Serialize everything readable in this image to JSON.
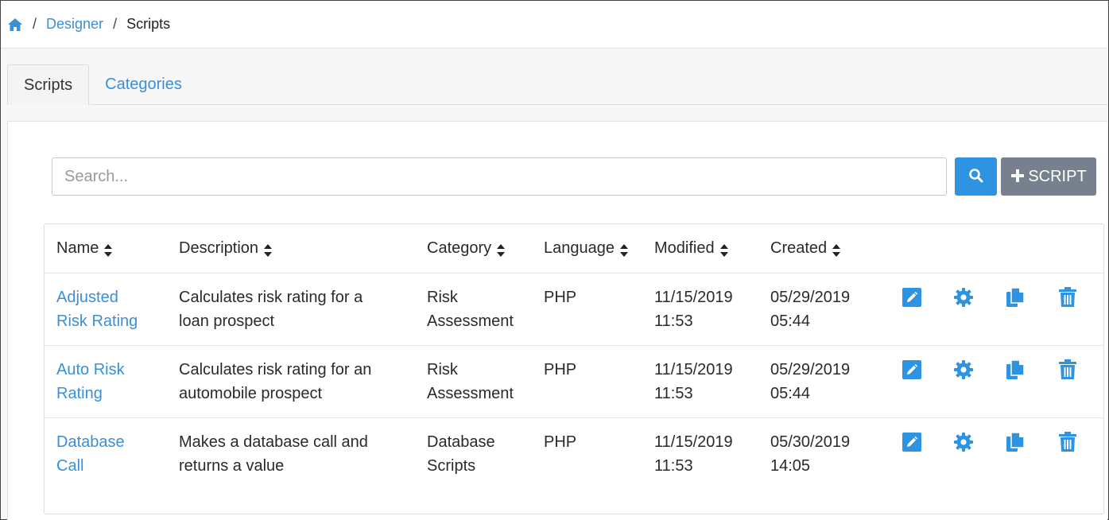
{
  "breadcrumb": {
    "separator": "/",
    "items": [
      {
        "label": "Designer"
      },
      {
        "label": "Scripts"
      }
    ]
  },
  "tabs": [
    {
      "label": "Scripts",
      "active": true
    },
    {
      "label": "Categories",
      "active": false
    }
  ],
  "search": {
    "placeholder": "Search...",
    "value": ""
  },
  "add_button": {
    "label": "SCRIPT"
  },
  "table": {
    "columns": [
      {
        "label": "Name"
      },
      {
        "label": "Description"
      },
      {
        "label": "Category"
      },
      {
        "label": "Language"
      },
      {
        "label": "Modified"
      },
      {
        "label": "Created"
      }
    ],
    "rows": [
      {
        "name_l1": "Adjusted",
        "name_l2": "Risk Rating",
        "desc_l1": "Calculates risk rating for a",
        "desc_l2": "loan prospect",
        "cat_l1": "Risk",
        "cat_l2": "Assessment",
        "language": "PHP",
        "modified_date": "11/15/2019",
        "modified_time": "11:53",
        "created_date": "05/29/2019",
        "created_time": "05:44"
      },
      {
        "name_l1": "Auto Risk",
        "name_l2": "Rating",
        "desc_l1": "Calculates risk rating for an",
        "desc_l2": "automobile prospect",
        "cat_l1": "Risk",
        "cat_l2": "Assessment",
        "language": "PHP",
        "modified_date": "11/15/2019",
        "modified_time": "11:53",
        "created_date": "05/29/2019",
        "created_time": "05:44"
      },
      {
        "name_l1": "Database",
        "name_l2": "Call",
        "desc_l1": "Makes a database call and",
        "desc_l2": "returns a value",
        "cat_l1": "Database",
        "cat_l2": "Scripts",
        "language": "PHP",
        "modified_date": "11/15/2019",
        "modified_time": "11:53",
        "created_date": "05/30/2019",
        "created_time": "14:05"
      }
    ]
  },
  "colors": {
    "link": "#3a8fd6",
    "primary_button": "#2e93e0",
    "secondary_button": "#77818d",
    "icon": "#2e93e0"
  },
  "icons": {
    "home": "home-icon",
    "search": "search-icon",
    "add": "plus-icon",
    "sort": "sort-icon",
    "edit": "edit-icon",
    "configure": "gear-icon",
    "copy": "copy-icon",
    "delete": "trash-icon"
  }
}
